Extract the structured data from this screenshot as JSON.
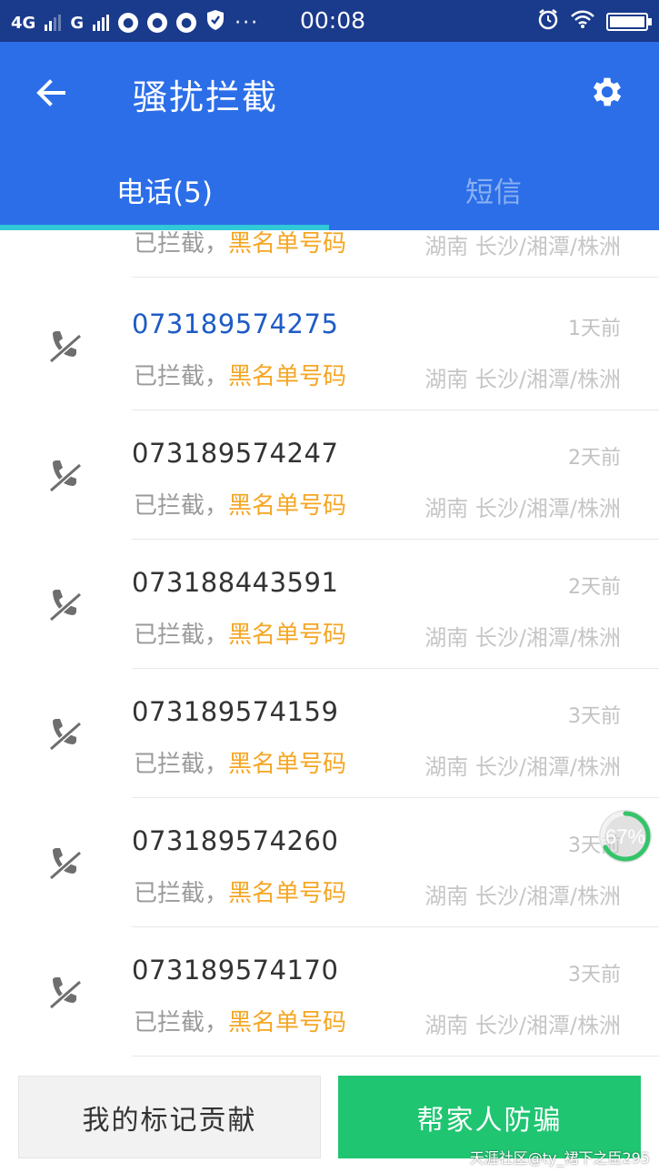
{
  "status_bar": {
    "network1": "4G",
    "network2": "G",
    "more": "···",
    "time": "00:08"
  },
  "header": {
    "title": "骚扰拦截"
  },
  "tabs": [
    {
      "label": "电话(5)",
      "selected": true
    },
    {
      "label": "短信",
      "selected": false
    }
  ],
  "calls": [
    {
      "number": "",
      "time": "",
      "status": "已拦截，",
      "tag": "黑名单号码",
      "location": "湖南 长沙/湘潭/株洲"
    },
    {
      "number": "073189574275",
      "time": "1天前",
      "status": "已拦截，",
      "tag": "黑名单号码",
      "location": "湖南 长沙/湘潭/株洲"
    },
    {
      "number": "073189574247",
      "time": "2天前",
      "status": "已拦截，",
      "tag": "黑名单号码",
      "location": "湖南 长沙/湘潭/株洲"
    },
    {
      "number": "073188443591",
      "time": "2天前",
      "status": "已拦截，",
      "tag": "黑名单号码",
      "location": "湖南 长沙/湘潭/株洲"
    },
    {
      "number": "073189574159",
      "time": "3天前",
      "status": "已拦截，",
      "tag": "黑名单号码",
      "location": "湖南 长沙/湘潭/株洲"
    },
    {
      "number": "073189574260",
      "time": "3天前",
      "status": "已拦截，",
      "tag": "黑名单号码",
      "location": "湖南 长沙/湘潭/株洲"
    },
    {
      "number": "073189574170",
      "time": "3天前",
      "status": "已拦截，",
      "tag": "黑名单号码",
      "location": "湖南 长沙/湘潭/株洲"
    }
  ],
  "progress_badge": {
    "label": "67%",
    "value": 0.67
  },
  "bottom": {
    "contrib_label": "我的标记贡献",
    "family_label": "帮家人防骗"
  },
  "watermark": "天涯社区@ty_裙下之臣295",
  "colors": {
    "status_bar": "#1a3a8c",
    "app_bar": "#2b6ee8",
    "tab_indicator": "#31c8d8",
    "tag_orange": "#f5a623",
    "highlight_blue": "#1e5bc6",
    "green_button": "#20c572"
  },
  "icons": {
    "back": "arrow-left-icon",
    "settings": "gear-icon",
    "blocked_call": "blocked-call-icon"
  }
}
